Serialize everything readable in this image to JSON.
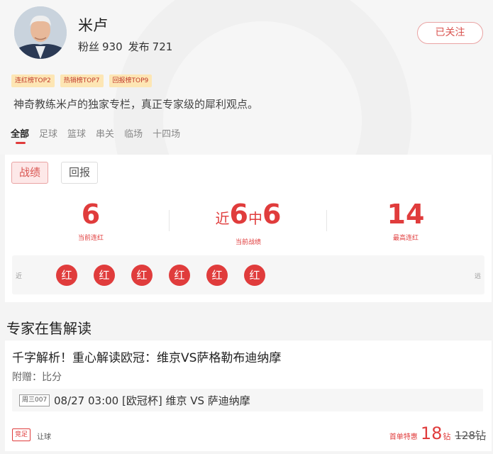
{
  "profile": {
    "name": "米卢",
    "fans_label": "粉丝",
    "fans_count": "930",
    "posts_label": "发布",
    "posts_count": "721",
    "follow_label": "已关注",
    "badges": [
      "连红榜TOP2",
      "热销榜TOP7",
      "回报榜TOP9"
    ],
    "description": "神奇教练米卢的独家专栏，真正专家级的犀利观点。"
  },
  "tabs": [
    "全部",
    "足球",
    "篮球",
    "串关",
    "临场",
    "十四场"
  ],
  "record": {
    "tabs": [
      "战绩",
      "回报"
    ],
    "current_streak": "6",
    "current_streak_label": "当前连红",
    "recent_prefix": "近",
    "recent_total": "6",
    "recent_mid": "中",
    "recent_hits": "6",
    "recent_label": "当前战绩",
    "max_streak": "14",
    "max_streak_label": "最高连红",
    "near_label": "近",
    "far_label": "远",
    "results": [
      "红",
      "红",
      "红",
      "红",
      "红",
      "红"
    ]
  },
  "section_title": "专家在售解读",
  "article": {
    "title": "千字解析！重心解读欧冠：维京VS萨格勒布迪纳摩",
    "gift": "附赠：比分",
    "match_tag": "周三007",
    "match_text": "08/27 03:00 [欧冠杯] 维京 VS 萨迪纳摩",
    "play_tag": "竞足",
    "play_type": "让球",
    "promo_label": "首单特惠",
    "price_now": "18",
    "price_unit": "钻",
    "price_old": "128钻"
  },
  "colors": {
    "accent": "#e03c3c",
    "badge_bg": "#fde6b4",
    "page_bg": "#f4f4f4"
  }
}
